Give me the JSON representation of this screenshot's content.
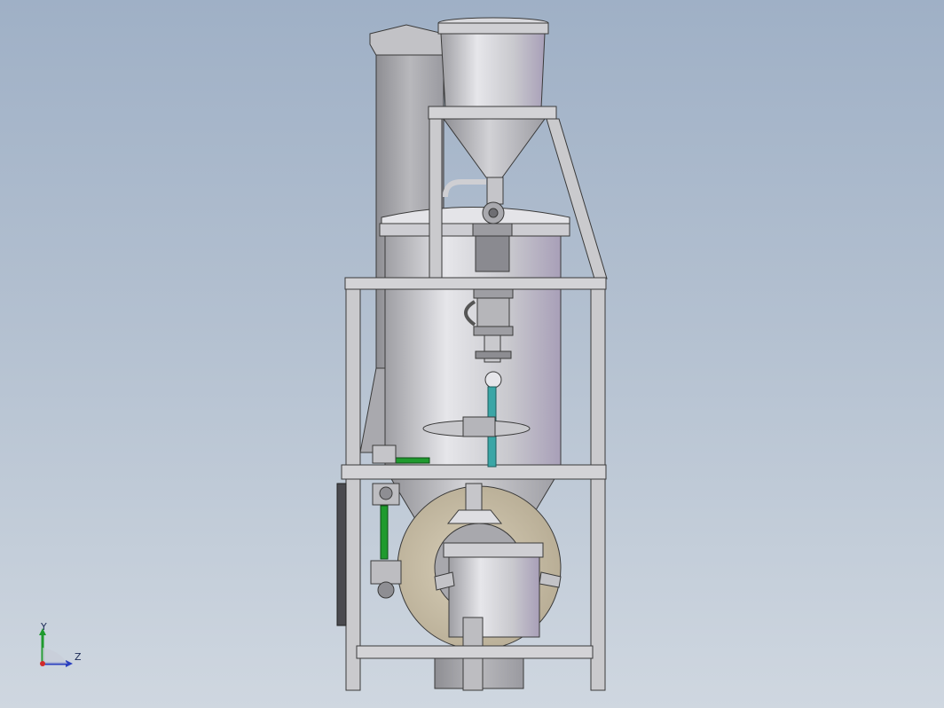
{
  "viewport": {
    "background_top": "#9fb0c6",
    "background_bottom": "#cfd7e0"
  },
  "model": {
    "metal_color": "#b9b9bd",
    "frame_color": "#c9c9cc",
    "edge_color": "#3a3a3a",
    "green_pipe_color": "#1f9a2e",
    "teal_pipe_color": "#3aa6a6",
    "disk_color": "#c8bda6"
  },
  "triad": {
    "y_label": "Y",
    "z_label": "Z",
    "y_color": "#1f9a2e",
    "z_color": "#2a3fbf",
    "origin_color": "#d12a2a"
  }
}
